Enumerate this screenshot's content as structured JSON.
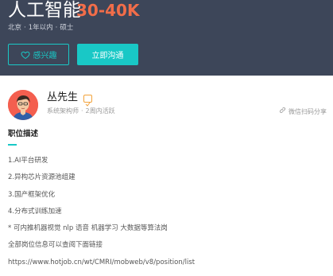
{
  "job": {
    "title": "人工智能",
    "salary": "30-40K",
    "location": "北京",
    "experience": "1年以内",
    "education": "硕士"
  },
  "actions": {
    "interest_label": "感兴趣",
    "chat_label": "立即沟通"
  },
  "recruiter": {
    "name": "丛先生",
    "role": "系统架构师",
    "active": "2周内活跃",
    "share_label": "微信扫码分享"
  },
  "description": {
    "section_title": "职位描述",
    "lines": [
      "1.AI平台研发",
      "2.异构芯片资源池组建",
      "3.国产框架优化",
      "4.分布式训练加速",
      "* 可内推机器视觉 nlp 语音 机器学习 大数据等算法岗",
      "全部岗位信息可以查阅下面链接",
      "https://www.hotjob.cn/wt/CMRI/mobweb/v8/position/list"
    ]
  },
  "colors": {
    "header_bg": "#3d4659",
    "accent": "#19c8c6",
    "salary": "#f26d49"
  }
}
